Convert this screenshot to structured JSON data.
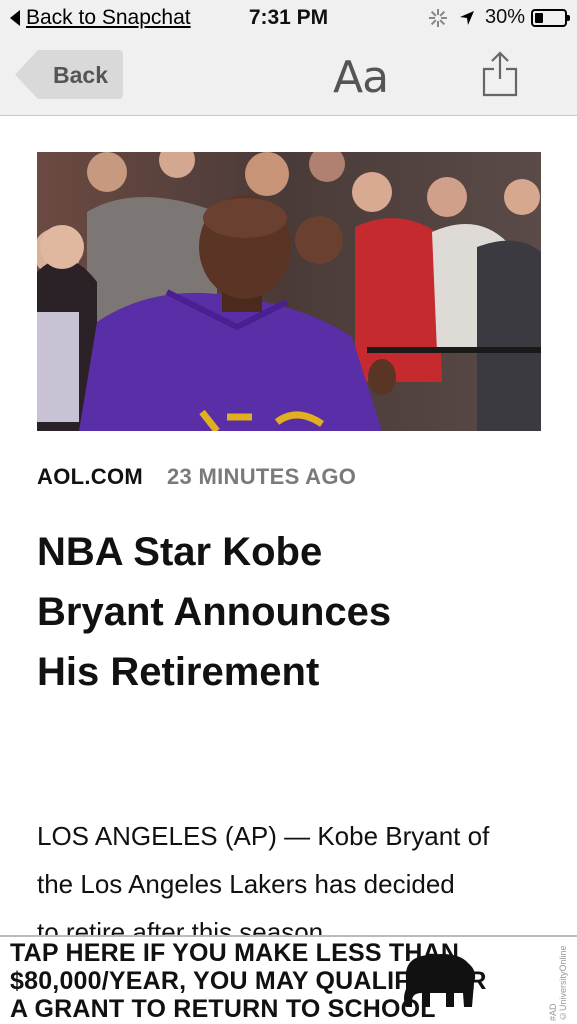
{
  "status_bar": {
    "back_label": "Back to Snapchat",
    "time": "7:31 PM",
    "battery_text": "30%",
    "battery_level": 0.3
  },
  "nav": {
    "back_label": "Back",
    "text_size_label": "Aa",
    "share_icon": "share-icon"
  },
  "article": {
    "source": "AOL.COM",
    "time_ago": "23 MINUTES AGO",
    "headline_lines": [
      "NBA Star Kobe",
      "Bryant Announces",
      "His Retirement"
    ],
    "body_lines": [
      "LOS ANGELES (AP) — Kobe Bryant of",
      "the Los Angeles Lakers has decided",
      "to retire after this season."
    ]
  },
  "ad": {
    "line1": "TAP HERE IF YOU MAKE LESS THAN",
    "line2": "$80,000/YEAR, YOU MAY QUALIFY FOR",
    "line3": "A GRANT TO RETURN TO SCHOOL",
    "fine_print": "#AD ©UniversityOnline"
  },
  "colors": {
    "bar_bg": "#f0f0f0",
    "jersey_purple": "#5a2ea6",
    "meta_gray": "#7a7a7a"
  }
}
